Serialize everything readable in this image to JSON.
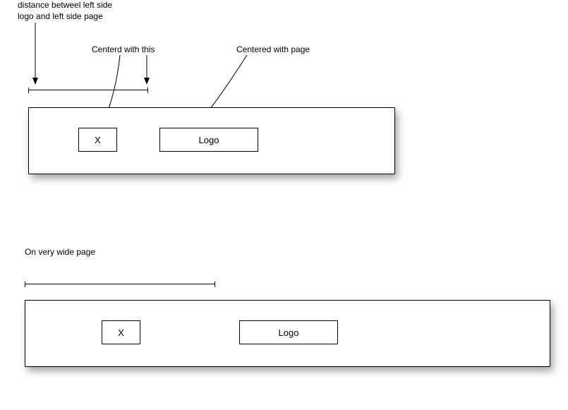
{
  "annotations": {
    "distance_label": "distance betweel left side\nlogo and left side page",
    "centered_with_this": "Centerd with this",
    "centered_with_page": "Centered  with page",
    "on_very_wide_page": "On very wide  page"
  },
  "top_diagram": {
    "x_box": "X",
    "logo_box": "Logo"
  },
  "bottom_diagram": {
    "x_box": "X",
    "logo_box": "Logo"
  }
}
